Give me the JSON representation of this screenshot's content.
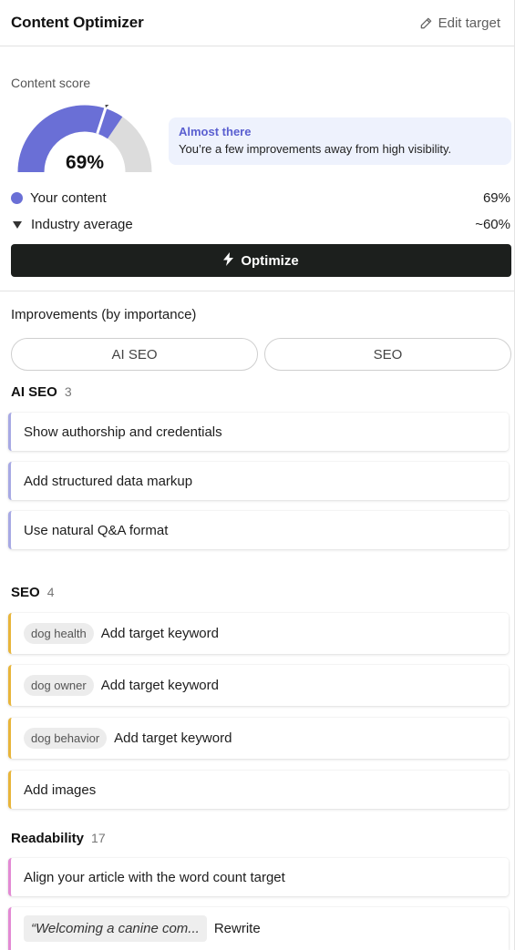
{
  "header": {
    "title": "Content Optimizer",
    "edit_label": "Edit target"
  },
  "score": {
    "label": "Content score",
    "value_text": "69%",
    "value": 69,
    "industry_average": 60,
    "callout_title": "Almost there",
    "callout_text": "You’re a few improvements away from high visibility.",
    "legend": [
      {
        "label": "Your content",
        "value": "69%"
      },
      {
        "label": "Industry average",
        "value": "~60%"
      }
    ],
    "colors": {
      "content": "#6a6fd6",
      "track": "#dcdcdc",
      "marker": "#444444"
    }
  },
  "optimize_label": "Optimize",
  "improvements": {
    "heading": "Improvements (by importance)",
    "tabs": [
      "AI SEO",
      "SEO"
    ],
    "groups": {
      "ai_seo": {
        "name": "AI SEO",
        "count": "3",
        "items": [
          "Show authorship and credentials",
          "Add structured data markup",
          "Use natural Q&A format"
        ]
      },
      "seo": {
        "name": "SEO",
        "count": "4",
        "items": [
          {
            "chip": "dog health",
            "label": "Add target keyword"
          },
          {
            "chip": "dog owner",
            "label": "Add target keyword"
          },
          {
            "chip": "dog behavior",
            "label": "Add target keyword"
          },
          {
            "label": "Add images"
          }
        ]
      },
      "readability": {
        "name": "Readability",
        "count": "17",
        "items": [
          {
            "label": "Align your article with the word count target"
          },
          {
            "quote": "“Welcoming a canine com...",
            "label": "Rewrite"
          }
        ]
      }
    }
  }
}
